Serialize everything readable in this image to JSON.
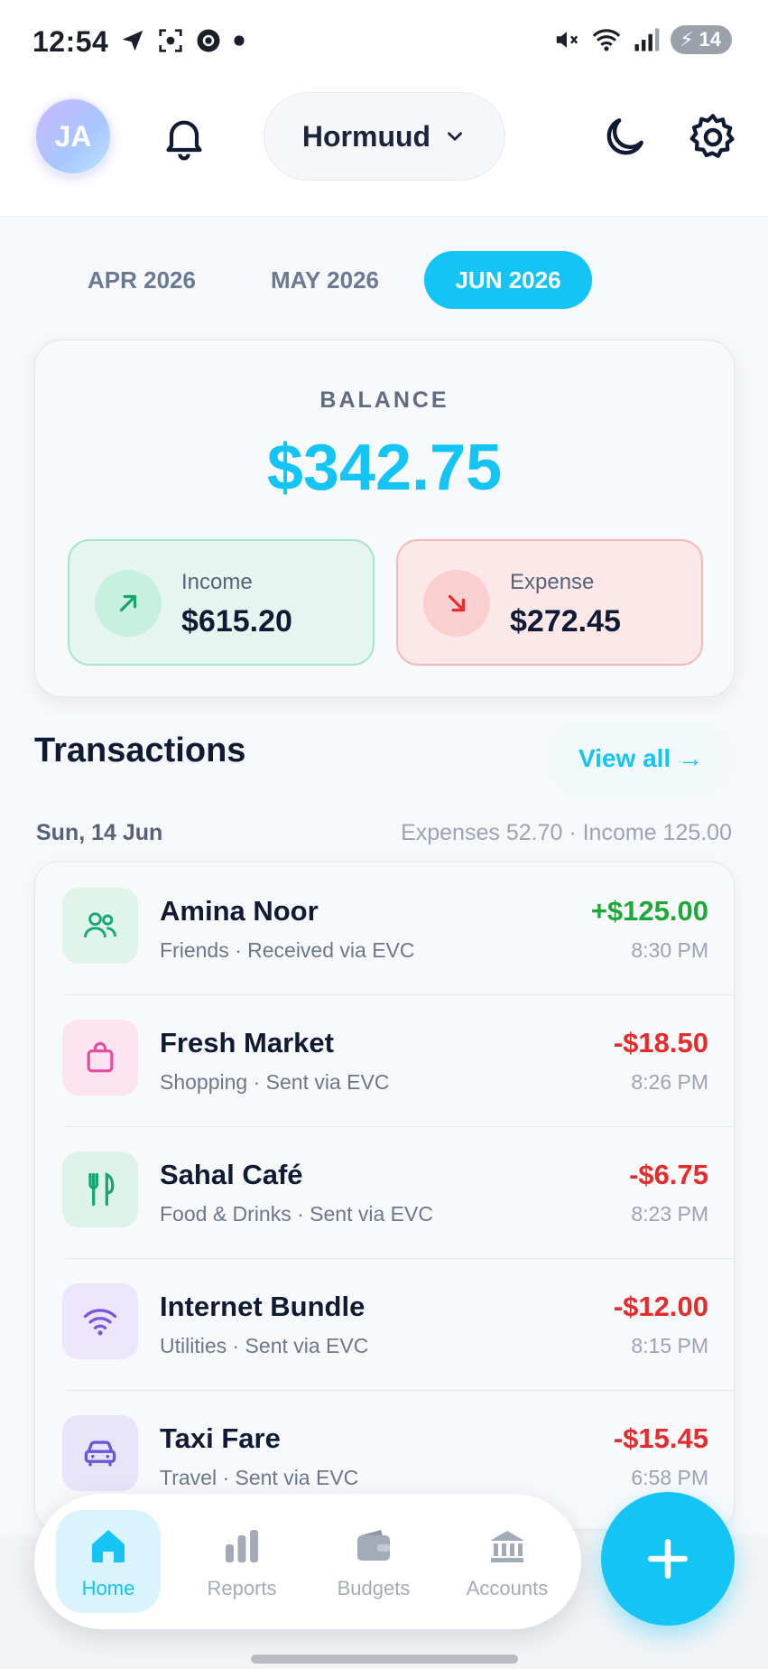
{
  "status_bar": {
    "time": "12:54",
    "battery": "14"
  },
  "header": {
    "avatar_initials": "JA",
    "provider": "Hormuud"
  },
  "months": [
    {
      "label": "APR 2026",
      "active": false
    },
    {
      "label": "MAY 2026",
      "active": false
    },
    {
      "label": "JUN 2026",
      "active": true
    }
  ],
  "balance": {
    "label": "BALANCE",
    "amount": "$342.75",
    "income_label": "Income",
    "income_value": "$615.20",
    "expense_label": "Expense",
    "expense_value": "$272.45"
  },
  "transactions": {
    "title": "Transactions",
    "view_all": "View all →",
    "day_label": "Sun, 14 Jun",
    "day_summary": "Expenses 52.70 · Income 125.00",
    "items": [
      {
        "title": "Amina Noor",
        "sub": "Friends · Received via EVC",
        "amount": "+$125.00",
        "time": "8:30 PM",
        "icon": "friends-icon"
      },
      {
        "title": "Fresh Market",
        "sub": "Shopping · Sent via EVC",
        "amount": "-$18.50",
        "time": "8:26 PM",
        "icon": "shopping-bag-icon"
      },
      {
        "title": "Sahal Café",
        "sub": "Food & Drinks · Sent via EVC",
        "amount": "-$6.75",
        "time": "8:23 PM",
        "icon": "utensils-icon"
      },
      {
        "title": "Internet Bundle",
        "sub": "Utilities · Sent via EVC",
        "amount": "-$12.00",
        "time": "8:15 PM",
        "icon": "wifi-icon"
      },
      {
        "title": "Taxi Fare",
        "sub": "Travel · Sent via EVC",
        "amount": "-$15.45",
        "time": "6:58 PM",
        "icon": "car-icon"
      }
    ]
  },
  "nav": {
    "items": [
      {
        "label": "Home",
        "active": true
      },
      {
        "label": "Reports",
        "active": false
      },
      {
        "label": "Budgets",
        "active": false
      },
      {
        "label": "Accounts",
        "active": false
      }
    ]
  },
  "colors": {
    "accent": "#13c4f4",
    "income": "#1fa83a",
    "expense": "#e52b2b"
  }
}
